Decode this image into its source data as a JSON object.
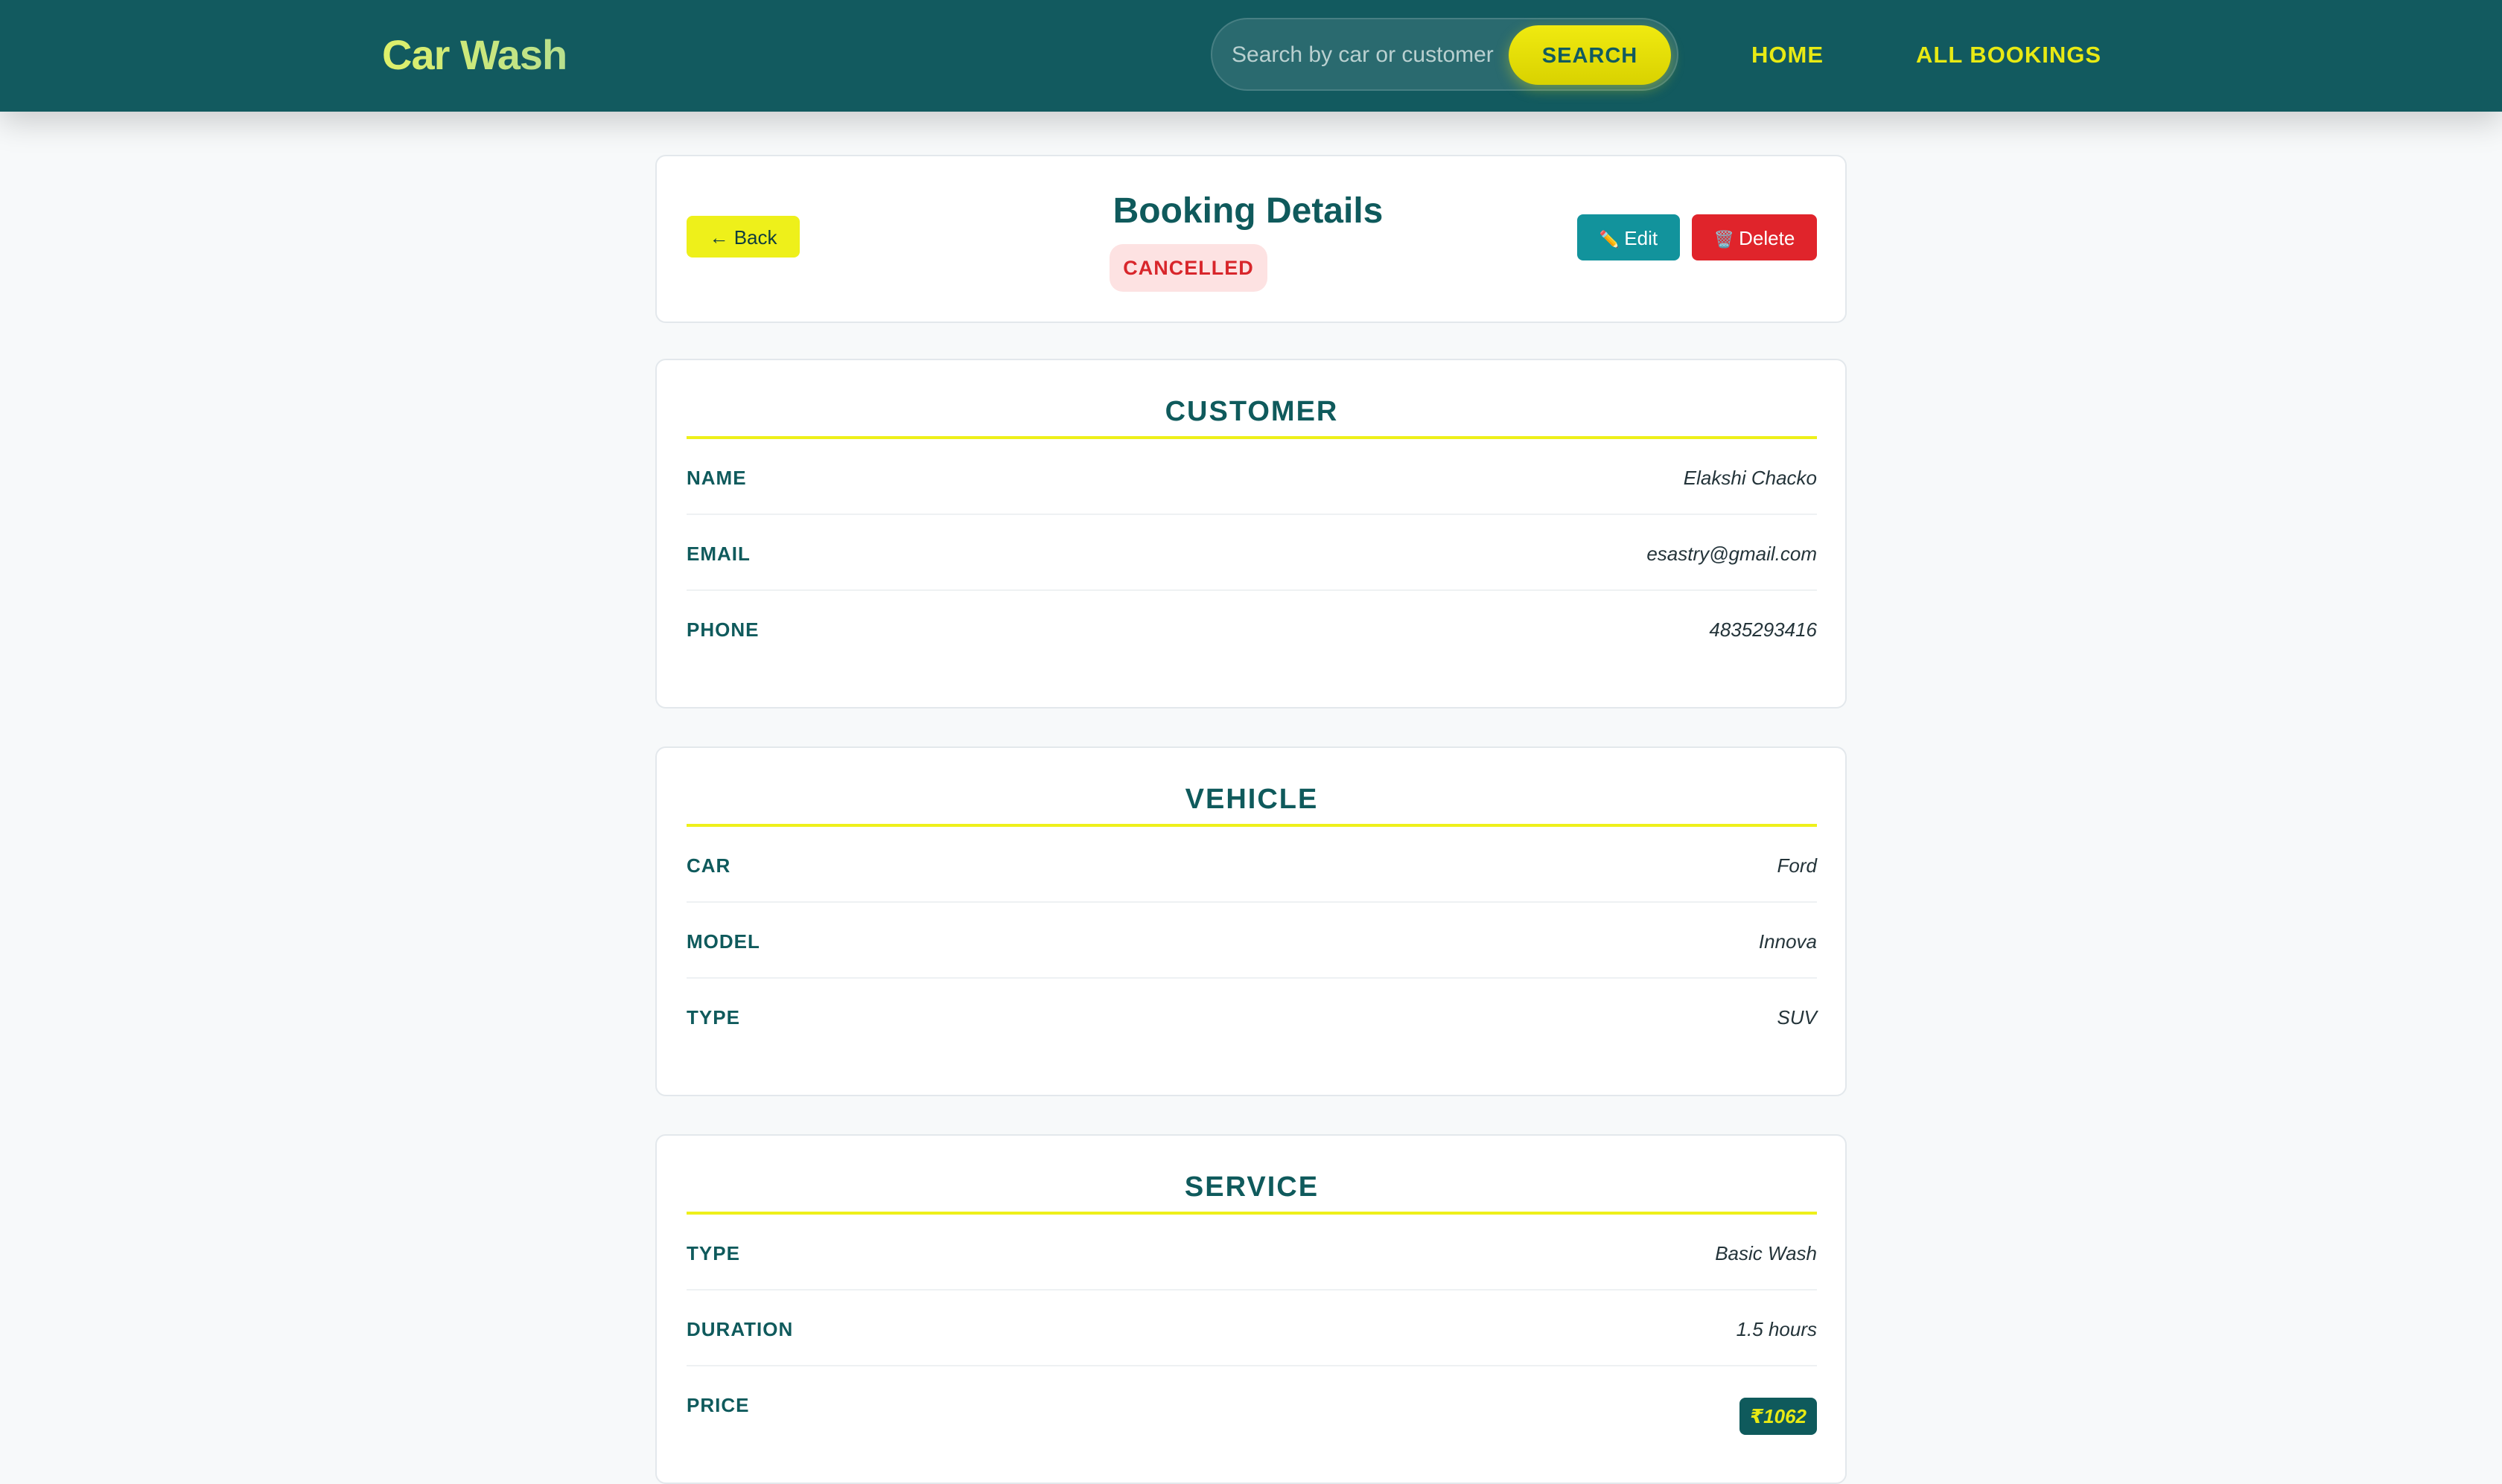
{
  "navbar": {
    "brand": "Car Wash",
    "search": {
      "placeholder": "Search by car or customer",
      "button_label": "SEARCH"
    },
    "links": {
      "home": "HOME",
      "all_bookings": "ALL BOOKINGS"
    }
  },
  "header": {
    "back_label": "← Back",
    "title": "Booking Details",
    "status": "CANCELLED",
    "edit_label": "Edit",
    "delete_label": "Delete"
  },
  "customer": {
    "title": "CUSTOMER",
    "rows": [
      {
        "label": "NAME",
        "value": "Elakshi Chacko"
      },
      {
        "label": "EMAIL",
        "value": "esastry@gmail.com"
      },
      {
        "label": "PHONE",
        "value": "4835293416"
      }
    ]
  },
  "vehicle": {
    "title": "VEHICLE",
    "rows": [
      {
        "label": "CAR",
        "value": "Ford"
      },
      {
        "label": "MODEL",
        "value": "Innova"
      },
      {
        "label": "TYPE",
        "value": "SUV"
      }
    ]
  },
  "service": {
    "title": "SERVICE",
    "rows": [
      {
        "label": "TYPE",
        "value": "Basic Wash"
      },
      {
        "label": "DURATION",
        "value": "1.5 hours"
      },
      {
        "label": "PRICE",
        "value": "₹1062"
      }
    ]
  },
  "colors": {
    "navbar_bg": "#125a5f",
    "accent_yellow": "#eef01a",
    "teal_text": "#0f5a5c",
    "edit_bg": "#12939c",
    "delete_bg": "#e0242b",
    "cancelled_text": "#d8262b",
    "cancelled_bg": "#fde2e2"
  },
  "icons": {
    "edit": "pencil-icon",
    "delete": "trash-icon"
  }
}
